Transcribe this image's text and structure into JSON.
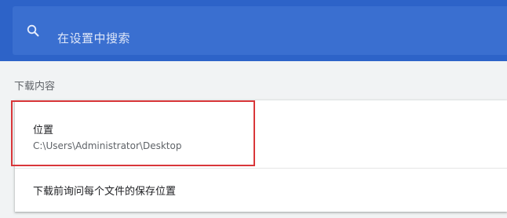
{
  "search": {
    "placeholder": "在设置中搜索",
    "icon": "search-icon"
  },
  "downloads": {
    "section_title": "下载内容",
    "location": {
      "label": "位置",
      "path": "C:\\Users\\Administrator\\Desktop"
    },
    "ask_before": {
      "label": "下载前询问每个文件的保存位置"
    }
  },
  "colors": {
    "header_bg": "#2d63c8",
    "highlight_border": "#d9373a"
  }
}
